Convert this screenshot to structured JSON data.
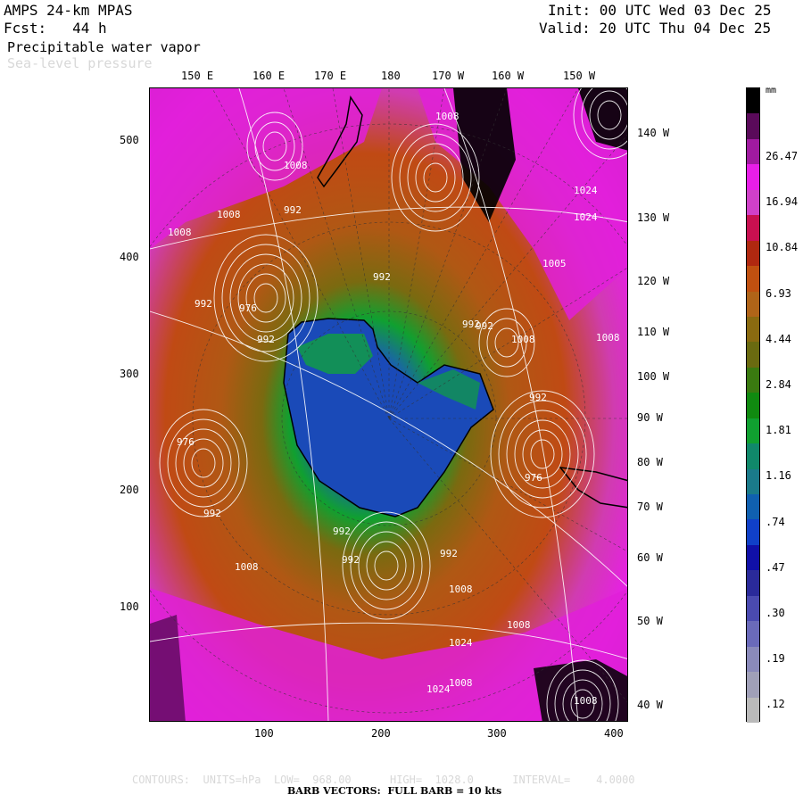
{
  "header": {
    "model": "AMPS 24-km MPAS",
    "forecast": "Fcst:   44 h",
    "init": "Init: 00 UTC Wed 03 Dec 25",
    "valid": "Valid: 20 UTC Thu 04 Dec 25",
    "field1": "Precipitable water vapor",
    "field2": "Sea-level pressure"
  },
  "top_lon_labels": [
    "150 E",
    "160 E",
    "170 E",
    "180",
    "170 W",
    "160 W",
    "150 W"
  ],
  "right_lon_labels": [
    "140 W",
    "130 W",
    "120 W",
    "110 W",
    "100 W",
    "90 W",
    "80 W",
    "70 W",
    "60 W",
    "50 W",
    "40 W"
  ],
  "y_axis_labels": [
    "500",
    "400",
    "300",
    "200",
    "100"
  ],
  "x_axis_labels": [
    "100",
    "200",
    "300",
    "400"
  ],
  "isobar_labels": [
    "1008",
    "1008",
    "992",
    "1008",
    "1008",
    "992",
    "976",
    "992",
    "1005",
    "992",
    "992",
    "1008",
    "976",
    "992",
    "992",
    "1008",
    "992",
    "992",
    "1008",
    "1008",
    "1024",
    "1024",
    "1008",
    "1008",
    "1024",
    "1024",
    "992",
    "976",
    "992",
    "1008"
  ],
  "colorbar": {
    "unit": "mm",
    "labels": [
      "26.47",
      "16.94",
      "10.84",
      "6.93",
      "4.44",
      "2.84",
      "1.81",
      "1.16",
      ".74",
      ".47",
      ".30",
      ".19",
      ".12"
    ],
    "colors": [
      "#000000",
      "#5a0a5a",
      "#a01aa0",
      "#e81ee8",
      "#d040c8",
      "#c81050",
      "#b02810",
      "#c05010",
      "#b06418",
      "#8a6a10",
      "#6a6a10",
      "#3a7a10",
      "#108a10",
      "#10a030",
      "#10886a",
      "#1a7a8a",
      "#1060b0",
      "#1040c8",
      "#1010a8",
      "#2a2a9a",
      "#4a4ab0",
      "#6a6aba",
      "#8a8aba",
      "#a0a0b8",
      "#bababa"
    ]
  },
  "footer": {
    "contours": "CONTOURS:  UNITS=hPa  LOW=  968.00      HIGH=  1028.0      INTERVAL=    4.0000",
    "barbs": "BARB VECTORS:  FULL BARB = 10 kts"
  }
}
